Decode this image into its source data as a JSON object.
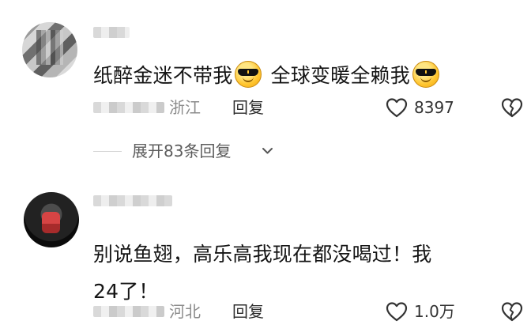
{
  "comments": [
    {
      "text_part_1": "纸醉金迷不带我",
      "text_part_2": " 全球变暖全赖我",
      "emoji_name": "sunglasses-emoji",
      "location": "浙江",
      "reply_label": "回复",
      "like_count": "8397",
      "expand_replies": "展开83条回复"
    },
    {
      "text": "别说鱼翅，高乐高我现在都没喝过！我24了！",
      "location": "河北",
      "reply_label": "回复",
      "like_count": "1.0万"
    }
  ],
  "icons": {
    "like": "heart-outline-icon",
    "dislike": "broken-heart-icon",
    "expand": "chevron-down-icon"
  },
  "colors": {
    "text": "#151515",
    "secondary": "#8b8b8b",
    "emoji": "#ffc52f"
  }
}
